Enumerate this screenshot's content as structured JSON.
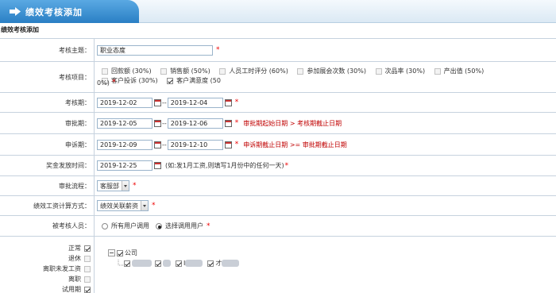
{
  "header": {
    "title": "绩效考核添加"
  },
  "section_title": "绩效考核添加",
  "subject": {
    "label": "考核主题：",
    "value": "职业态度"
  },
  "items": {
    "label": "考核项目：",
    "options": [
      {
        "label": "回款额 (30%)",
        "checked": false
      },
      {
        "label": "销售额 (50%)",
        "checked": false
      },
      {
        "label": "人员工时评分 (60%)",
        "checked": false
      },
      {
        "label": "参加展会次数 (30%)",
        "checked": false
      },
      {
        "label": "次品率 (30%)",
        "checked": false
      },
      {
        "label": "产出值 (50%)",
        "checked": false
      },
      {
        "label": "客户投诉 (30%)",
        "checked": false
      },
      {
        "label": "客户满意度 (50",
        "checked": true
      }
    ],
    "wrap_text": "0%)"
  },
  "assess_period": {
    "label": "考核期：",
    "start": "2019-12-02",
    "sep": "--",
    "end": "2019-12-04"
  },
  "approve_period": {
    "label": "审批期：",
    "start": "2019-12-05",
    "sep": "--",
    "end": "2019-12-06",
    "hint": "审批期起始日期 > 考核期截止日期"
  },
  "appeal_period": {
    "label": "申诉期：",
    "start": "2019-12-09",
    "sep": "--",
    "end": "2019-12-10",
    "hint": "申诉期截止日期 >= 审批期截止日期"
  },
  "bonus_time": {
    "label": "奖金发放时间：",
    "value": "2019-12-25",
    "hint": "(如:发1月工资,则填写1月份中的任何一天)"
  },
  "approval_flow": {
    "label": "审批流程：",
    "value": "客服部"
  },
  "calc_method": {
    "label": "绩效工资计算方式：",
    "value": "绩效关联薪资"
  },
  "assessed": {
    "label": "被考核人员：",
    "option_all": "所有用户调用",
    "option_select": "选择调用用户",
    "selected": "option_select"
  },
  "status_list": [
    {
      "label": "正常",
      "checked": true,
      "disabled": false
    },
    {
      "label": "退休",
      "checked": false,
      "disabled": true
    },
    {
      "label": "离职未发工资",
      "checked": false,
      "disabled": true
    },
    {
      "label": "离职",
      "checked": false,
      "disabled": true
    },
    {
      "label": "试用期",
      "checked": true,
      "disabled": false
    }
  ],
  "tree": {
    "root_label": "公司",
    "child_3_prefix": "I",
    "child_4_prefix": "才"
  },
  "required_mark": "*",
  "colors": {
    "header_blue": "#2a7fc4",
    "required_red": "#e00000",
    "hint_red": "#c00000",
    "border": "#c6d2de"
  }
}
